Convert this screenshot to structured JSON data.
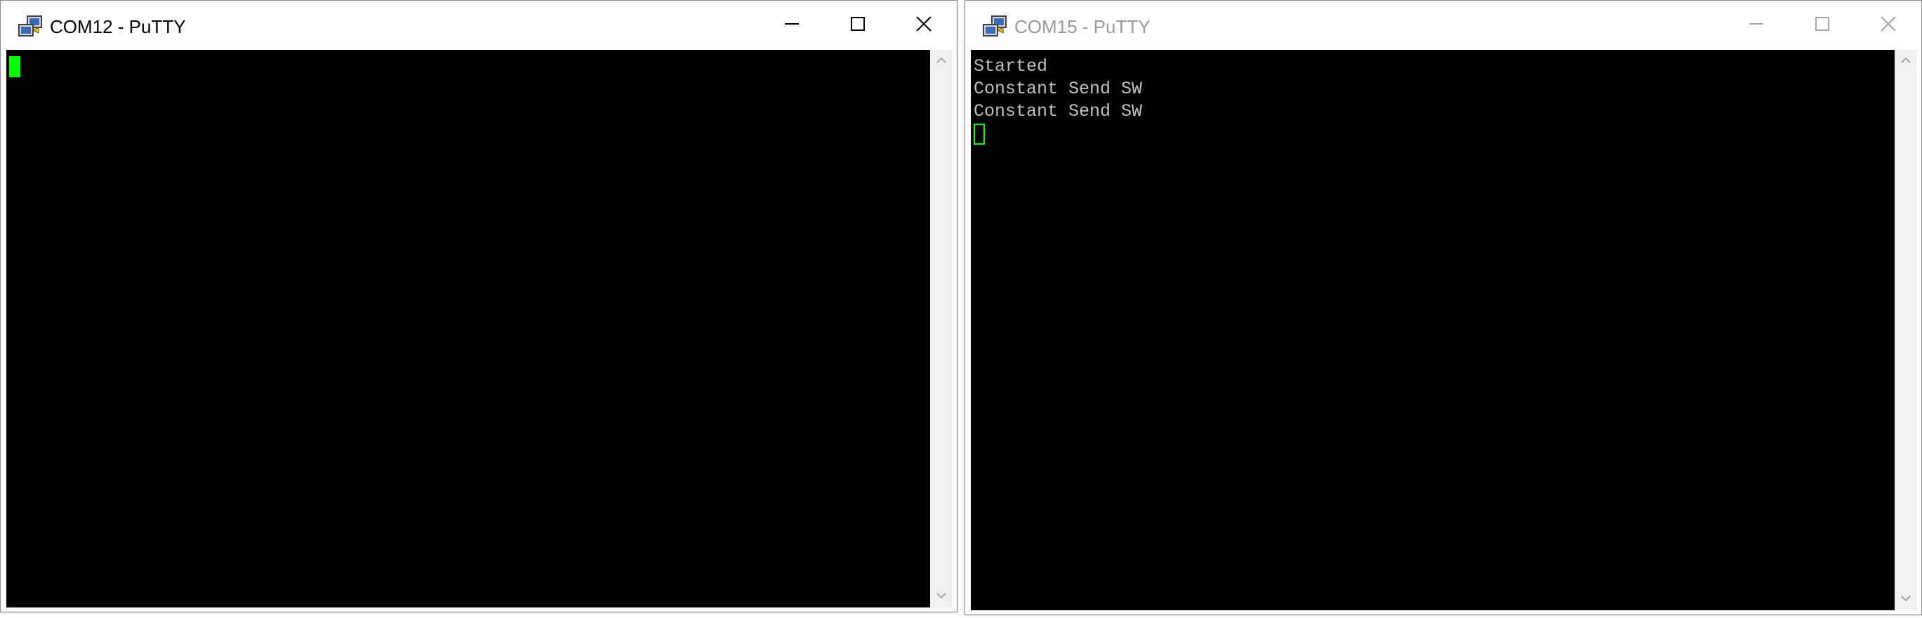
{
  "windows": [
    {
      "title": "COM12 - PuTTY",
      "state": "active",
      "lines": [],
      "cursor": "filled"
    },
    {
      "title": "COM15 - PuTTY",
      "state": "inactive",
      "lines": [
        "Started",
        "Constant Send SW",
        "Constant Send SW"
      ],
      "cursor": "hollow"
    }
  ],
  "colors": {
    "terminal_bg": "#000000",
    "terminal_fg": "#c0c0c0",
    "cursor": "#00ff00",
    "inactive_title": "#9a9a9a"
  },
  "icons": [
    "putty-app-icon",
    "minimize-icon",
    "maximize-icon",
    "close-icon",
    "scroll-up-arrow-icon",
    "scroll-down-arrow-icon"
  ]
}
